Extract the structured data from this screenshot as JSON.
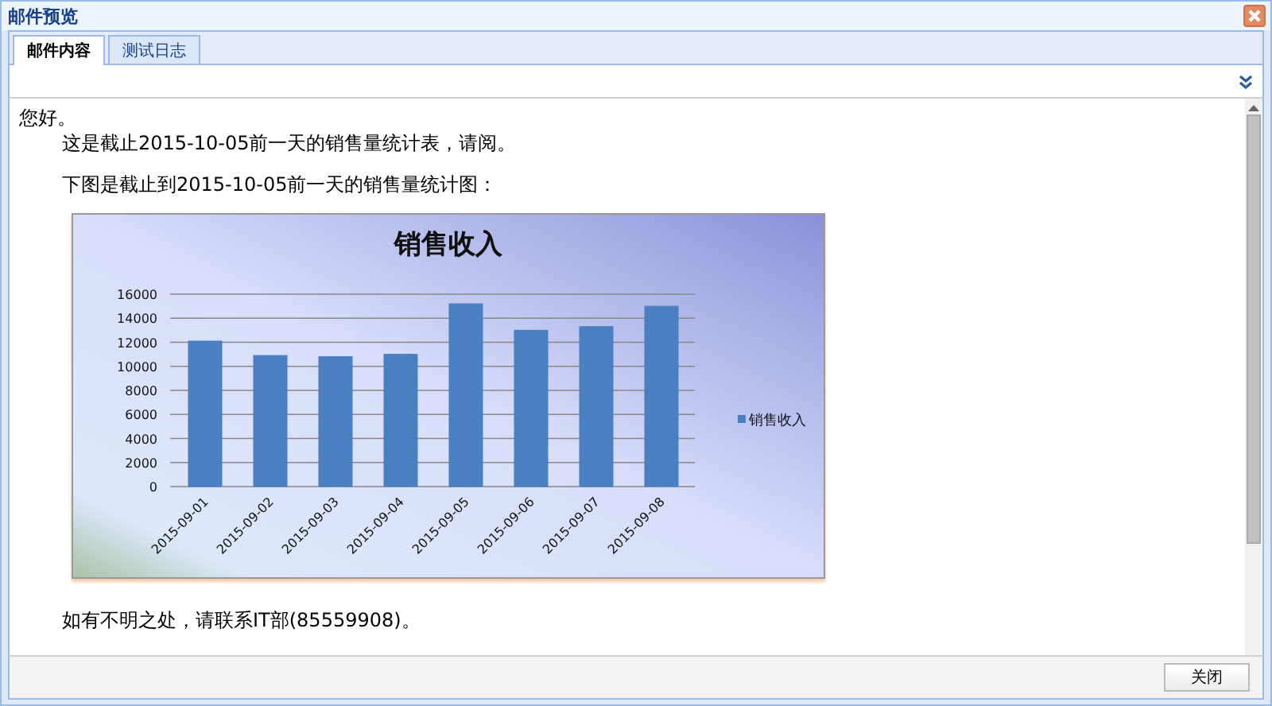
{
  "window": {
    "title": "邮件预览"
  },
  "tabs": [
    {
      "label": "邮件内容",
      "selected": true
    },
    {
      "label": "测试日志",
      "selected": false
    }
  ],
  "message": {
    "greeting": "您好。",
    "line_1": "这是截止2015-10-05前一天的销售量统计表，请阅。",
    "line_2": "下图是截止到2015-10-05前一天的销售量统计图：",
    "chart_data": {
      "type": "bar",
      "title": "销售收入",
      "categories": [
        "2015-09-01",
        "2015-09-02",
        "2015-09-03",
        "2015-09-04",
        "2015-09-05",
        "2015-09-06",
        "2015-09-07",
        "2015-09-08"
      ],
      "series": [
        {
          "name": "销售收入",
          "color": "#4a7fc1",
          "values": [
            12100,
            10900,
            10800,
            11000,
            15200,
            13000,
            13300,
            15000
          ]
        }
      ],
      "grid": true,
      "ylim": [
        0,
        16000
      ],
      "yticks": [
        0,
        2000,
        4000,
        6000,
        8000,
        10000,
        12000,
        14000,
        16000
      ]
    },
    "closing": "如有不明之处，请联系IT部(85559908)。"
  },
  "buttons": [
    "关闭"
  ]
}
